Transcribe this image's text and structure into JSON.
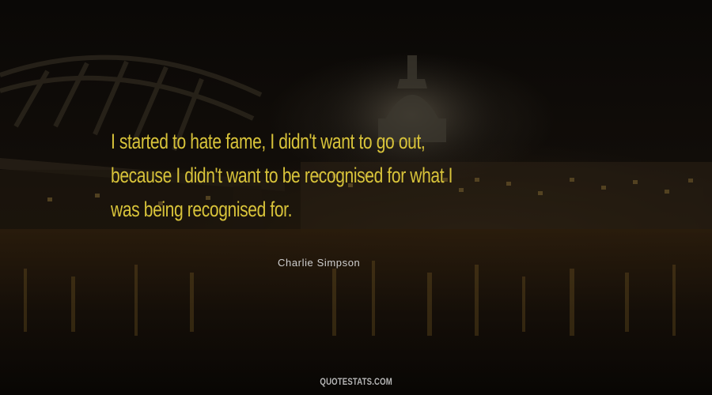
{
  "quote": {
    "lines": [
      "I started to hate fame, I didn't want to go out,",
      "because I didn't want to be recognised for what I",
      "was being recognised for."
    ],
    "color": "#d8c33a"
  },
  "author": {
    "name": "Charlie Simpson",
    "color": "#cfcfcf"
  },
  "footer": {
    "site": "QUOTESTATS.COM",
    "color": "#b5b5b5"
  },
  "background": {
    "scene": "city-night-river-photo",
    "base_color": "#0b0806"
  }
}
